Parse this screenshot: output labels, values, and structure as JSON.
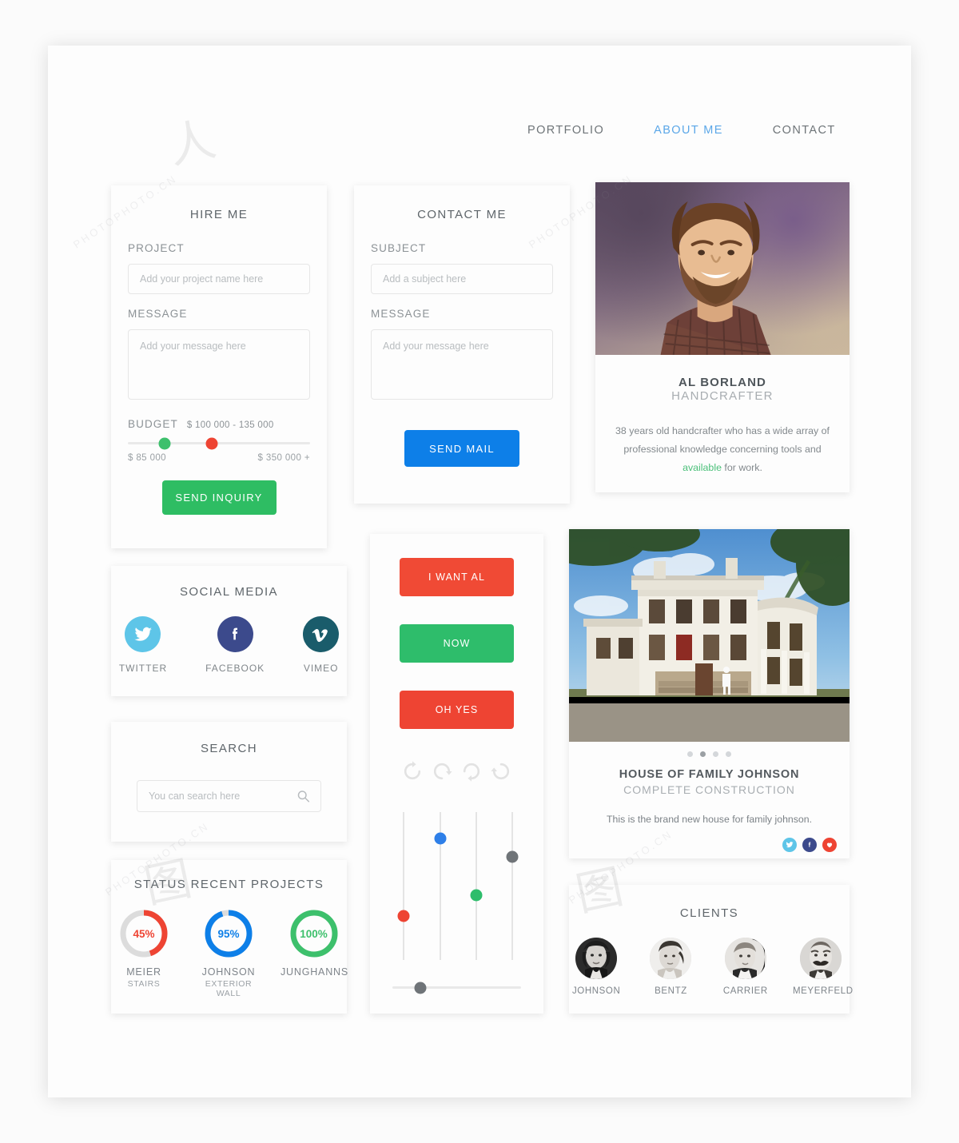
{
  "nav": {
    "items": [
      {
        "label": "PORTFOLIO",
        "active": false
      },
      {
        "label": "ABOUT ME",
        "active": true
      },
      {
        "label": "CONTACT",
        "active": false
      }
    ],
    "active_color": "#5ba7e8"
  },
  "hire_me": {
    "title": "HIRE ME",
    "project_label": "PROJECT",
    "project_placeholder": "Add your project name here",
    "project_value": "",
    "message_label": "MESSAGE",
    "message_placeholder": "Add your message here",
    "message_value": "",
    "budget_label": "BUDGET",
    "budget_value": "$ 100 000 - 135 000",
    "budget_min_label": "$ 85 000",
    "budget_max_label": "$ 350 000 +",
    "handle_low_pct": 20,
    "handle_high_pct": 46,
    "handle_low_color": "#3dc06c",
    "handle_high_color": "#ee4433",
    "submit_label": "SEND INQUIRY",
    "submit_color": "#2ebd63"
  },
  "contact_me": {
    "title": "CONTACT ME",
    "subject_label": "SUBJECT",
    "subject_placeholder": "Add a subject here",
    "subject_value": "",
    "message_label": "MESSAGE",
    "message_placeholder": "Add your message here",
    "message_value": "",
    "submit_label": "SEND MAIL",
    "submit_color": "#0d7fe8"
  },
  "profile": {
    "name": "AL BORLAND",
    "role": "HANDCRAFTER",
    "bio_before": "38 years old handcrafter who has a wide array of professional knowledge concerning tools and ",
    "bio_highlight": "available",
    "bio_after": " for work.",
    "highlight_color": "#4cc07a",
    "photo_alt": "portrait-photo"
  },
  "social_media": {
    "title": "SOCIAL MEDIA",
    "items": [
      {
        "label": "TWITTER",
        "icon": "twitter-icon",
        "color": "#5ec5e8"
      },
      {
        "label": "FACEBOOK",
        "icon": "facebook-icon",
        "color": "#3c4a8c"
      },
      {
        "label": "VIMEO",
        "icon": "vimeo-icon",
        "color": "#1a5c6b"
      }
    ]
  },
  "search": {
    "title": "SEARCH",
    "placeholder": "You can search here",
    "value": "",
    "icon": "search-icon"
  },
  "status": {
    "title": "STATUS RECENT PROJECTS",
    "items": [
      {
        "name": "MEIER",
        "sub": "STAIRS",
        "percent": 45,
        "label": "45%",
        "color": "#ee4433"
      },
      {
        "name": "JOHNSON",
        "sub": "EXTERIOR WALL",
        "percent": 95,
        "label": "95%",
        "color": "#0d7fe8"
      },
      {
        "name": "JUNGHANNS",
        "sub": "",
        "percent": 100,
        "label": "100%",
        "color": "#3dc06c"
      }
    ],
    "track_color": "#dcdcdc"
  },
  "controls": {
    "buttons": [
      {
        "label": "I WANT AL",
        "color": "#f04a35"
      },
      {
        "label": "NOW",
        "color": "#2ebd6b"
      },
      {
        "label": "OH YES",
        "color": "#ee4433"
      }
    ],
    "spinners": [
      {
        "name": "refresh-icon-1",
        "rotation": 0
      },
      {
        "name": "refresh-icon-2",
        "rotation": 90
      },
      {
        "name": "refresh-icon-3",
        "rotation": 180
      },
      {
        "name": "refresh-icon-4",
        "rotation": 270
      }
    ],
    "vertical_sliders": [
      {
        "name": "slider-1",
        "value_pct": 30,
        "color": "#ee4433"
      },
      {
        "name": "slider-2",
        "value_pct": 82,
        "color": "#2e7fe8"
      },
      {
        "name": "slider-3",
        "value_pct": 44,
        "color": "#2ebd6b"
      },
      {
        "name": "slider-4",
        "value_pct": 70,
        "color": "#6f7478"
      }
    ],
    "horizontal_slider": {
      "name": "slider-h",
      "value_pct": 22,
      "color": "#6f7478"
    }
  },
  "project": {
    "title": "HOUSE OF FAMILY JOHNSON",
    "subtitle": "COMPLETE CONSTRUCTION",
    "description": "This is the brand new house for family johnson.",
    "carousel_dots": 4,
    "carousel_active": 2,
    "share": [
      {
        "icon": "twitter-icon",
        "color": "#5ec5e8"
      },
      {
        "icon": "facebook-icon",
        "color": "#3c4a8c"
      },
      {
        "icon": "heart-icon",
        "color": "#ee4433"
      }
    ],
    "image_alt": "house-photo"
  },
  "clients": {
    "title": "CLIENTS",
    "items": [
      {
        "name": "JOHNSON",
        "avatar": "client-avatar-johnson"
      },
      {
        "name": "BENTZ",
        "avatar": "client-avatar-bentz"
      },
      {
        "name": "CARRIER",
        "avatar": "client-avatar-carrier"
      },
      {
        "name": "MEYERFELD",
        "avatar": "client-avatar-meyerfeld"
      }
    ]
  },
  "watermark": {
    "text": "PHOTOPHOTO.CN"
  }
}
